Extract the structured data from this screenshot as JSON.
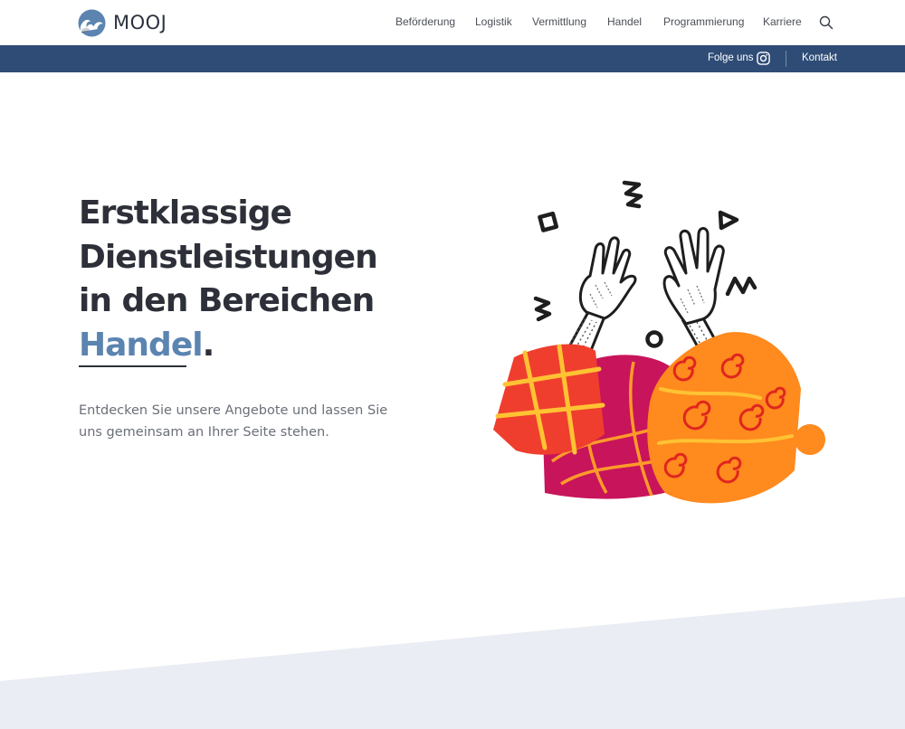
{
  "brand": {
    "name": "MOOJ",
    "logo_icon": "wave-logo-icon"
  },
  "nav": {
    "items": [
      {
        "label": "Beförderung"
      },
      {
        "label": "Logistik"
      },
      {
        "label": "Vermittlung"
      },
      {
        "label": "Handel"
      },
      {
        "label": "Programmierung"
      },
      {
        "label": "Karriere"
      }
    ],
    "search_icon": "search-icon"
  },
  "utility": {
    "follow_label": "Folge uns",
    "social_icon": "instagram-icon",
    "contact_label": "Kontakt"
  },
  "hero": {
    "title_lines": [
      "Erstklassige",
      "Dienstleistungen",
      "in den Bereichen"
    ],
    "highlight_word": "Handel",
    "highlight_punct": ".",
    "text": "Entdecken Sie unsere Angebote und lassen Sie uns gemeinsam an Ihrer Seite stehen.",
    "illustration": "high-five-illustration"
  },
  "colors": {
    "utility_bar": "#2f4c76",
    "accent": "#5b84b0",
    "heading": "#2d3038",
    "slant": "#eaedf3",
    "illus_red": "#ef3e2e",
    "illus_magenta": "#c8145a",
    "illus_orange": "#ff8a1e",
    "illus_yellow": "#ffc233"
  }
}
